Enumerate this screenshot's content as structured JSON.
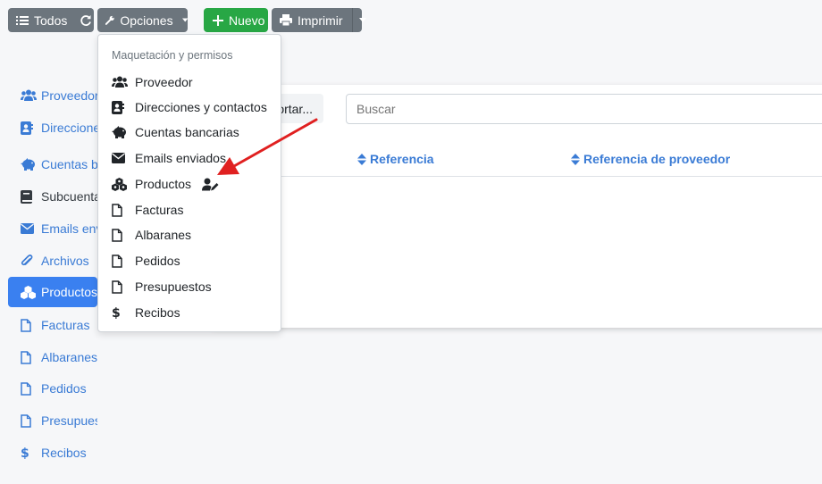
{
  "toolbar": {
    "all_label": "Todos",
    "options_label": "Opciones",
    "new_label": "Nuevo",
    "print_label": "Imprimir"
  },
  "sidebar": {
    "items": [
      {
        "label": "Proveedor",
        "icon": "users-icon"
      },
      {
        "label": "Direcciones y contactos",
        "icon": "address-book-icon"
      },
      {
        "label": "Cuentas bancarias",
        "icon": "piggy-bank-icon"
      },
      {
        "label": "Subcuentas",
        "icon": "book-icon"
      },
      {
        "label": "Emails enviados",
        "icon": "envelope-icon"
      },
      {
        "label": "Archivos",
        "icon": "paperclip-icon"
      },
      {
        "label": "Productos",
        "icon": "cubes-icon"
      },
      {
        "label": "Facturas",
        "icon": "file-icon"
      },
      {
        "label": "Albaranes",
        "icon": "file-icon"
      },
      {
        "label": "Pedidos",
        "icon": "file-icon"
      },
      {
        "label": "Presupuestos",
        "icon": "file-icon"
      },
      {
        "label": "Recibos",
        "icon": "dollar-icon"
      }
    ]
  },
  "main": {
    "sort_label": "ortar...",
    "search_placeholder": "Buscar",
    "columns": [
      "Referencia",
      "Referencia de proveedor"
    ]
  },
  "dropdown": {
    "header": "Maquetación y permisos",
    "items": [
      {
        "label": "Proveedor",
        "icon": "users-icon"
      },
      {
        "label": "Direcciones y contactos",
        "icon": "address-book-icon"
      },
      {
        "label": "Cuentas bancarias",
        "icon": "piggy-bank-icon"
      },
      {
        "label": "Emails enviados",
        "icon": "envelope-icon"
      },
      {
        "label": "Productos",
        "icon": "cubes-icon",
        "badge_icon": "user-edit-icon"
      },
      {
        "label": "Facturas",
        "icon": "file-icon"
      },
      {
        "label": "Albaranes",
        "icon": "file-icon"
      },
      {
        "label": "Pedidos",
        "icon": "file-icon"
      },
      {
        "label": "Presupuestos",
        "icon": "file-icon"
      },
      {
        "label": "Recibos",
        "icon": "dollar-icon"
      }
    ]
  },
  "colors": {
    "accent": "#3a80f0",
    "link": "#3a7bd5",
    "secondary": "#6c757d",
    "success": "#28a745",
    "annotation_arrow": "#e02020"
  }
}
